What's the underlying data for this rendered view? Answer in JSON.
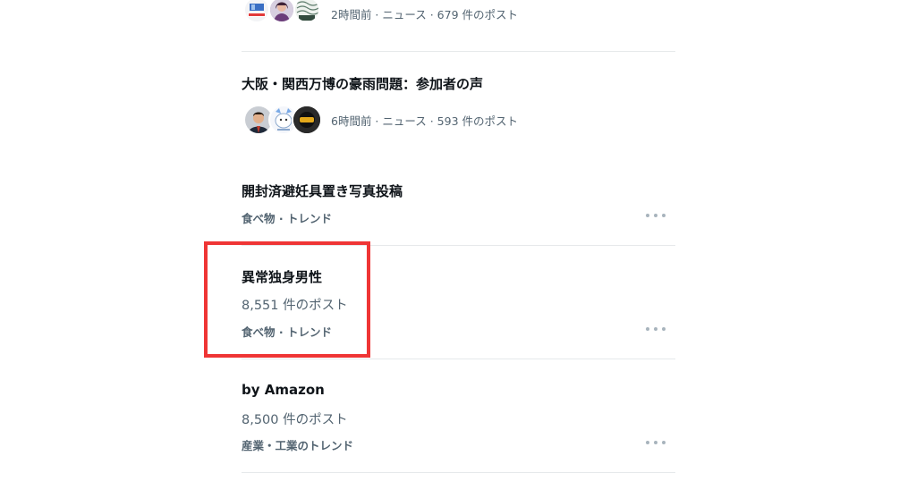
{
  "colors": {
    "highlight": "#ef3535",
    "text_primary": "#0f1419",
    "text_secondary": "#536471",
    "divider": "#e6e9eb",
    "more_dots": "#a8b4bd"
  },
  "trends": [
    {
      "kind": "news",
      "meta": "2時間前 · ニュース · 679 件のポスト",
      "avatars": [
        "yahoo-logo-avatar",
        "person-avatar",
        "erc-logo-avatar"
      ]
    },
    {
      "kind": "news",
      "title": "大阪・関西万博の豪雨問題：参加者の声",
      "meta": "6時間前 · ニュース · 593 件のポスト",
      "avatars": [
        "man-in-suit-avatar",
        "cartoon-avatar",
        "badge-logo-avatar"
      ]
    },
    {
      "kind": "trend",
      "title": "開封済避妊具置き写真投稿",
      "category": "食べ物 · トレンド"
    },
    {
      "kind": "trend",
      "title": "異常独身男性",
      "count": "8,551 件のポスト",
      "category": "食べ物 · トレンド",
      "highlighted": true
    },
    {
      "kind": "trend",
      "title": "by Amazon",
      "count": "8,500 件のポスト",
      "category": "産業・工業のトレンド"
    }
  ],
  "icons": {
    "more": "more-horizontal-icon"
  }
}
